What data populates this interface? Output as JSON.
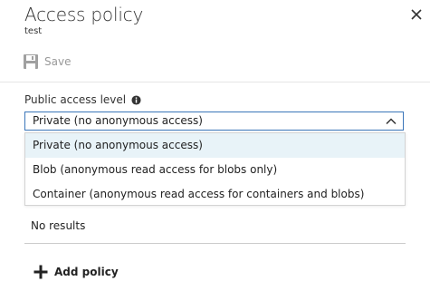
{
  "panel": {
    "title": "Access policy",
    "subtitle": "test"
  },
  "toolbar": {
    "save_label": "Save",
    "save_icon": "floppy-disk-icon",
    "close_icon": "close-icon"
  },
  "public_access": {
    "label": "Public access level",
    "info_icon": "info-icon",
    "selected_value": "Private (no anonymous access)",
    "options": [
      "Private (no anonymous access)",
      "Blob (anonymous read access for blobs only)",
      "Container (anonymous read access for containers and blobs)"
    ]
  },
  "policies": {
    "empty_text": "No results",
    "add_label": "Add policy",
    "add_icon": "plus-icon"
  },
  "colors": {
    "accent": "#3b76b9",
    "selected_option_bg": "#e8f3f8",
    "disabled_text": "#999999"
  }
}
